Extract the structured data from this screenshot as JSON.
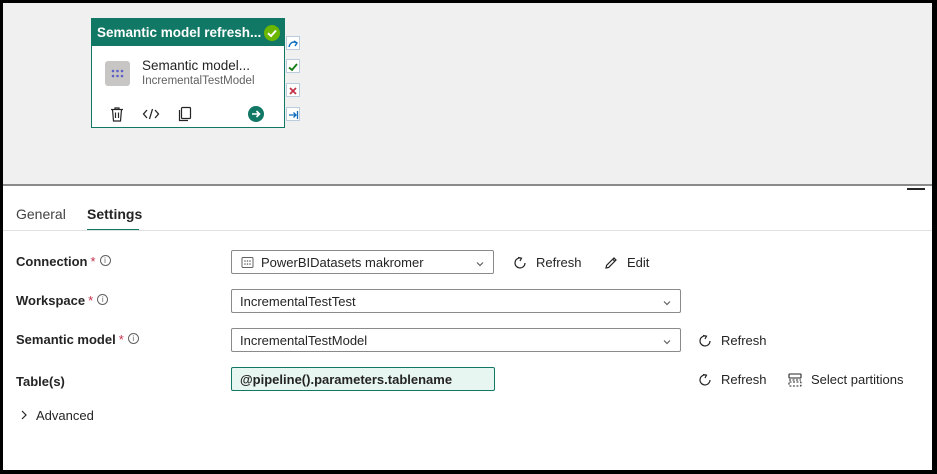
{
  "activity": {
    "header": "Semantic model refresh...",
    "title": "Semantic model...",
    "subtitle": "IncrementalTestModel",
    "colors": {
      "accent": "#117865",
      "success": "#6bb700",
      "fail": "#c4314b"
    },
    "icons": [
      "delete-icon",
      "code-icon",
      "copy-icon",
      "go-icon"
    ]
  },
  "tabs": {
    "general": "General",
    "settings": "Settings",
    "active": "Settings"
  },
  "connection": {
    "label": "Connection",
    "required": "*",
    "value": "PowerBIDatasets makromer",
    "refresh_label": "Refresh",
    "edit_label": "Edit"
  },
  "workspace": {
    "label": "Workspace",
    "required": "*",
    "value": "IncrementalTestTest"
  },
  "semantic_model": {
    "label": "Semantic model",
    "required": "*",
    "value": "IncrementalTestModel",
    "refresh_label": "Refresh"
  },
  "tables": {
    "label": "Table(s)",
    "value": "@pipeline().parameters.tablename",
    "refresh_label": "Refresh",
    "select_partitions_label": "Select partitions"
  },
  "advanced": {
    "label": "Advanced"
  }
}
